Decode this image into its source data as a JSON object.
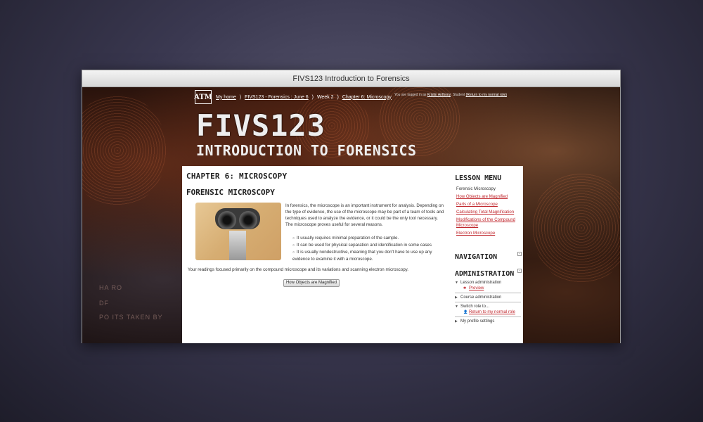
{
  "window": {
    "title": "FIVS123 Introduction to Forensics"
  },
  "header": {
    "logo": "ATM",
    "breadcrumb": {
      "home": "My home",
      "course": "FIVS123 - Forensics : June 6",
      "week": "Week 2",
      "chapter": "Chapter 6: Microscopy"
    },
    "login": {
      "prefix": "You are logged in as",
      "user": "Kristin Anthony",
      "role": ": Student",
      "return_link": "(Return to my normal role)"
    },
    "brand_line1": "FIVS123",
    "brand_line2": "INTRODUCTION TO FORENSICS",
    "background_texts": [
      "HA    RO",
      "DF",
      "PO      ITS TAKEN BY"
    ]
  },
  "main": {
    "chapter_title": "CHAPTER 6: MICROSCOPY",
    "section_title": "FORENSIC MICROSCOPY",
    "intro": "In forensics, the microscope is an important instrument for analysis. Depending on the type of evidence, the use of the microscope may be part of a team of tools and techniques used to analyze the evidence, or it could be the only tool necessary. The microscope proves useful for several reasons.",
    "points": [
      "It usually requires minimal preparation of the sample.",
      "It can be used for physical separation and identification in some cases",
      "It is usually nondestructive, meaning that you don't have to use up any evidence to examine it with a microscope."
    ],
    "summary": "Your readings focused primarily on the compound microscope and its variations and scanning electron microscopy.",
    "next_button": "How Objects are Magnified"
  },
  "sidebar": {
    "lesson_menu_title": "LESSON MENU",
    "lesson_items": [
      {
        "label": "Forensic Microscopy",
        "current": true
      },
      {
        "label": "How Objects are Magnified",
        "current": false
      },
      {
        "label": "Parts of a Microscope",
        "current": false
      },
      {
        "label": "Calculating Total Magnification",
        "current": false
      },
      {
        "label": "Modifications of the Compound Microscope",
        "current": false
      },
      {
        "label": "Electron Microscope",
        "current": false
      }
    ],
    "navigation_title": "NAVIGATION",
    "administration_title": "ADMINISTRATION",
    "admin": {
      "lesson_admin": "Lesson administration",
      "preview": "Preview",
      "course_admin": "Course administration",
      "switch_role": "Switch role to...",
      "return_role": "Return to my normal role",
      "profile": "My profile settings"
    }
  },
  "colors": {
    "link": "#c0272d",
    "accent_bg": "#120806"
  }
}
